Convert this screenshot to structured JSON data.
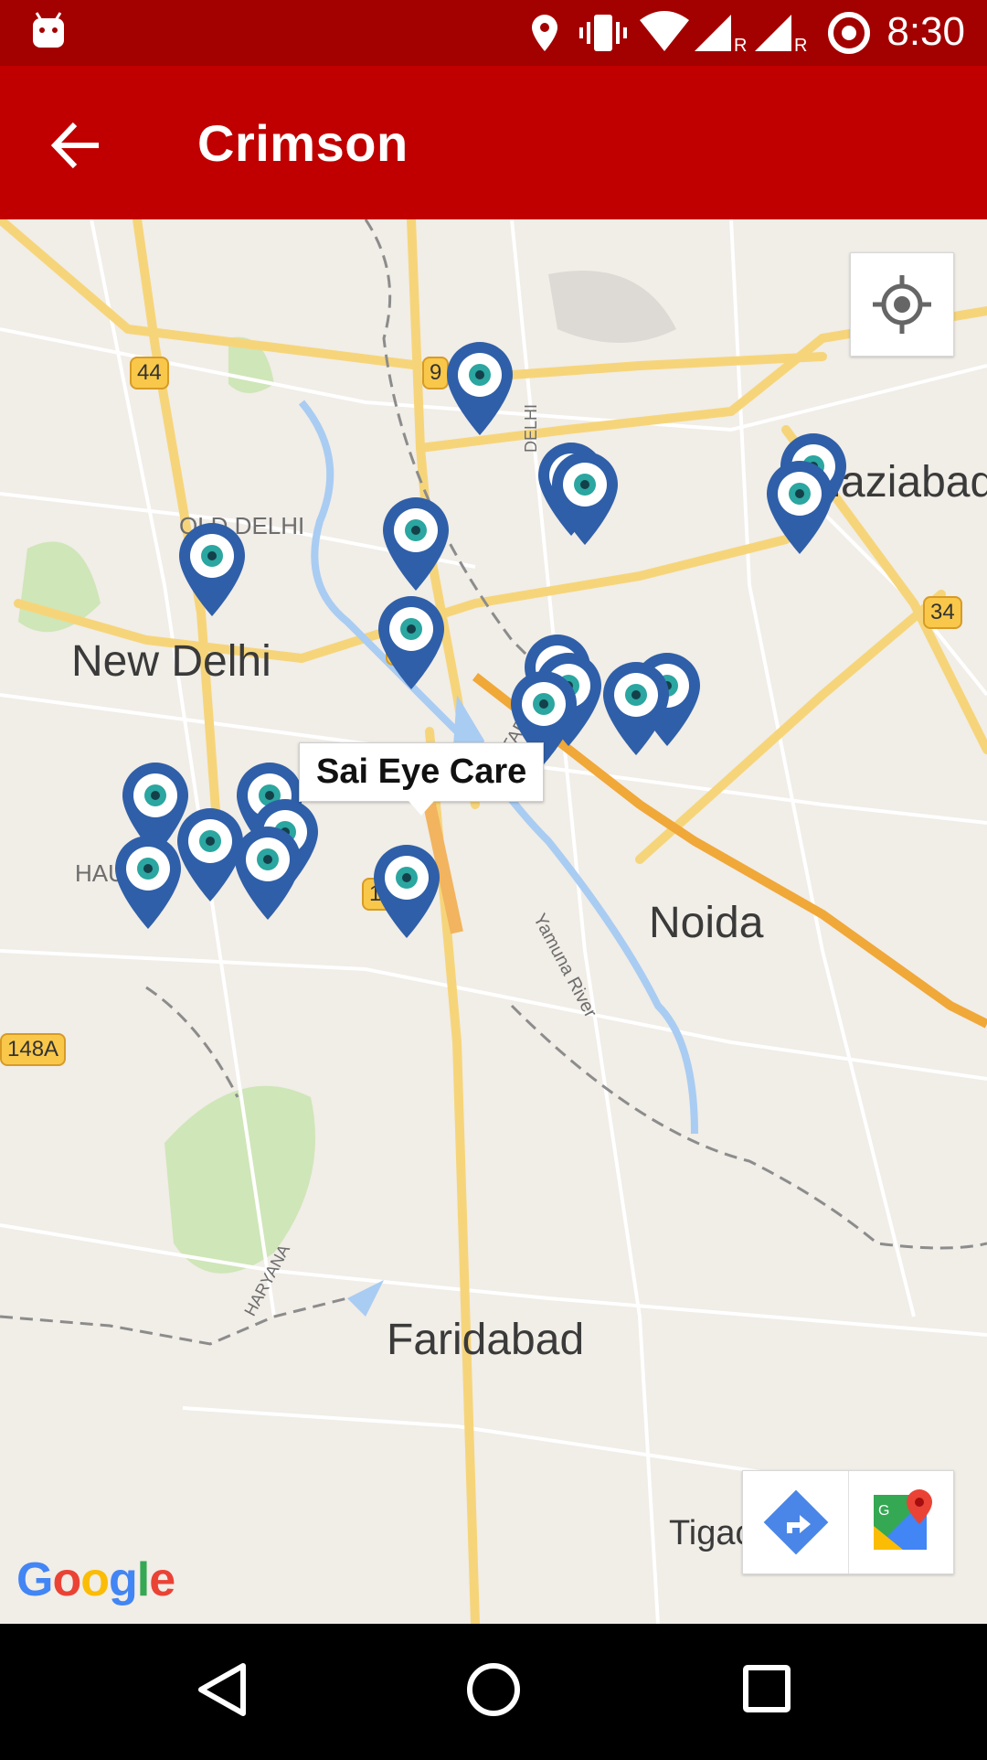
{
  "status_bar": {
    "time": "8:30",
    "icons": [
      "android-icon",
      "location-icon",
      "vibrate-icon",
      "wifi-icon",
      "signal-r-icon",
      "signal-r-icon",
      "target-icon"
    ]
  },
  "app_bar": {
    "title": "Crimson",
    "back_icon": "arrow-back-icon"
  },
  "map": {
    "city_labels": [
      "New Delhi",
      "Noida",
      "Faridabad",
      "Ghaziabad",
      "Tigaon"
    ],
    "area_labels": [
      "OLD DELHI",
      "HAUZ",
      "UTTAR PRADESH",
      "DELHI",
      "HARYANA",
      "Yamuna River"
    ],
    "road_shields": [
      "44",
      "9",
      "24",
      "34",
      "19",
      "148A"
    ],
    "callout": "Sai Eye Care",
    "my_location_icon": "crosshair-icon",
    "directions_icon": "directions-icon",
    "maps_app_icon": "google-maps-icon",
    "attribution": "Google"
  },
  "colors": {
    "status_bar": "#a30000",
    "app_bar": "#c00000",
    "pin": "#2f5fa8",
    "pin_center": "#2ba6a0"
  },
  "nav_bar": {
    "buttons": [
      "back-triangle-icon",
      "home-circle-icon",
      "recents-square-icon"
    ]
  }
}
